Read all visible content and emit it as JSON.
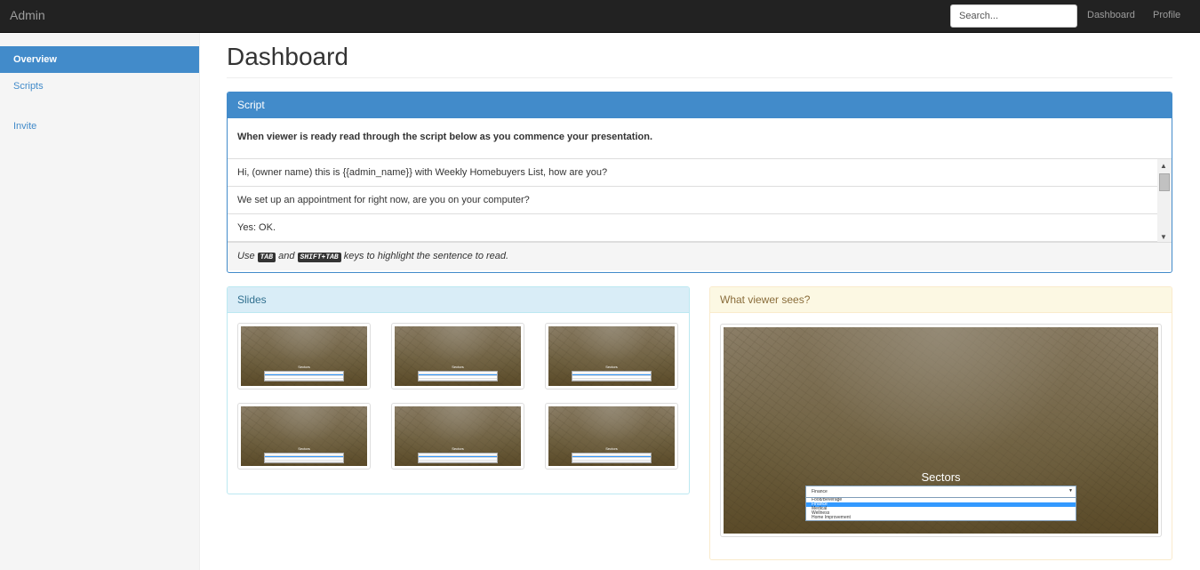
{
  "navbar": {
    "brand": "Admin",
    "search_placeholder": "Search...",
    "links": [
      "Dashboard",
      "Profile"
    ]
  },
  "sidebar": {
    "items": [
      {
        "label": "Overview",
        "active": true
      },
      {
        "label": "Scripts",
        "active": false
      },
      {
        "label": "Invite",
        "active": false
      }
    ]
  },
  "main": {
    "title": "Dashboard",
    "script_panel": {
      "heading": "Script",
      "instruction": "When viewer is ready read through the script below as you commence your presentation.",
      "lines": [
        "Hi, (owner name) this is {{admin_name}} with Weekly Homebuyers List, how are you?",
        "We set up an appointment for right now, are you on your computer?",
        "Yes: OK."
      ],
      "footer": {
        "use": "Use",
        "key1": "TAB",
        "and": "and",
        "key2": "SHIFT+TAB",
        "rest": "keys to highlight the sentence to read."
      }
    },
    "slides_panel": {
      "heading": "Slides",
      "slide_label": "Sectors",
      "slide_count": 6
    },
    "viewer_panel": {
      "heading": "What viewer sees?",
      "slide_title": "Sectors",
      "select_value": "Finance",
      "options": [
        "Food/Beverage",
        "Finance",
        "Medical",
        "Wellness",
        "Home Improvement"
      ],
      "selected_option": "Finance"
    }
  },
  "colors": {
    "primary": "#428bca",
    "navbar_bg": "#222222",
    "info_bg": "#d9edf7",
    "warning_bg": "#fcf8e3",
    "highlight": "#3399ff"
  }
}
